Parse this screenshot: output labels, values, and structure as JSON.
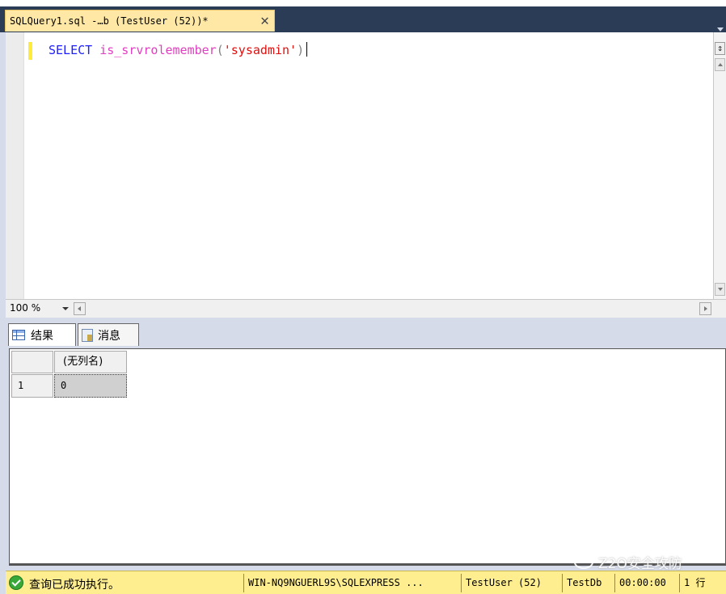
{
  "tab": {
    "title": "SQLQuery1.sql -…b (TestUser (52))*",
    "close_glyph": "✕"
  },
  "editor": {
    "code": {
      "keyword": "SELECT",
      "function": "is_srvrolemember",
      "open_paren": "(",
      "string": "'sysadmin'",
      "close_paren": ")"
    }
  },
  "zoom": {
    "value": "100 %"
  },
  "result_tabs": [
    {
      "label": "结果",
      "icon": "grid-icon"
    },
    {
      "label": "消息",
      "icon": "message-icon"
    }
  ],
  "results": {
    "columns": [
      "(无列名)"
    ],
    "rows": [
      {
        "row_number": "1",
        "cells": [
          "0"
        ]
      }
    ]
  },
  "status": {
    "message": "查询已成功执行。",
    "server": "WIN-NQ9NGUERL9S\\SQLEXPRESS ...",
    "user": "TestUser (52)",
    "database": "TestDb",
    "elapsed": "00:00:00",
    "rows": "1 行",
    "message_color": "#ffee90"
  },
  "watermark": {
    "text": "Z2O安全攻防"
  }
}
